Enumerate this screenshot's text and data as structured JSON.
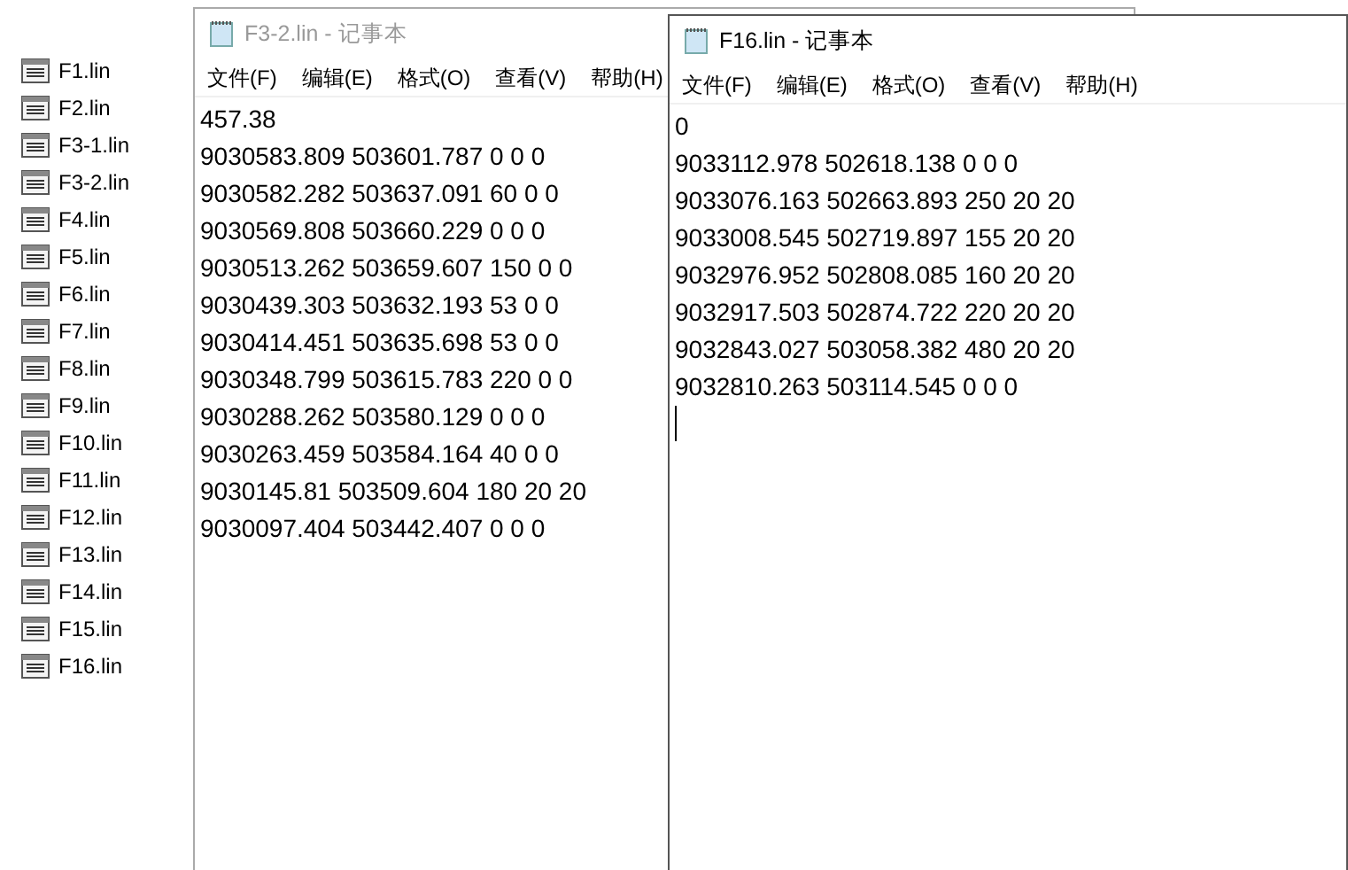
{
  "desktop_files": [
    {
      "label": "F1.lin"
    },
    {
      "label": "F2.lin"
    },
    {
      "label": "F3-1.lin"
    },
    {
      "label": "F3-2.lin"
    },
    {
      "label": "F4.lin"
    },
    {
      "label": "F5.lin"
    },
    {
      "label": "F6.lin"
    },
    {
      "label": "F7.lin"
    },
    {
      "label": "F8.lin"
    },
    {
      "label": "F9.lin"
    },
    {
      "label": "F10.lin"
    },
    {
      "label": "F11.lin"
    },
    {
      "label": "F12.lin"
    },
    {
      "label": "F13.lin"
    },
    {
      "label": "F14.lin"
    },
    {
      "label": "F15.lin"
    },
    {
      "label": "F16.lin"
    }
  ],
  "windows": [
    {
      "title": "F3-2.lin - 记事本",
      "active": false,
      "menu": [
        "文件(F)",
        "编辑(E)",
        "格式(O)",
        "查看(V)",
        "帮助(H)"
      ],
      "lines": [
        "457.38",
        "9030583.809 503601.787 0 0 0",
        "9030582.282 503637.091 60 0 0",
        "9030569.808 503660.229 0 0 0",
        "9030513.262 503659.607 150 0 0",
        "9030439.303 503632.193 53 0 0",
        "9030414.451 503635.698 53 0 0",
        "9030348.799 503615.783 220 0 0",
        "9030288.262 503580.129 0 0 0",
        "9030263.459 503584.164 40 0 0",
        "9030145.81 503509.604 180 20 20",
        "9030097.404 503442.407 0 0 0"
      ]
    },
    {
      "title": "F16.lin - 记事本",
      "active": true,
      "caret": true,
      "menu": [
        "文件(F)",
        "编辑(E)",
        "格式(O)",
        "查看(V)",
        "帮助(H)"
      ],
      "lines": [
        "0",
        "9033112.978 502618.138 0 0 0",
        "9033076.163 502663.893 250 20 20",
        "9033008.545 502719.897 155 20 20",
        "9032976.952 502808.085 160 20 20",
        "9032917.503 502874.722 220 20 20",
        "9032843.027 503058.382 480 20 20",
        "9032810.263 503114.545 0 0 0"
      ]
    }
  ]
}
